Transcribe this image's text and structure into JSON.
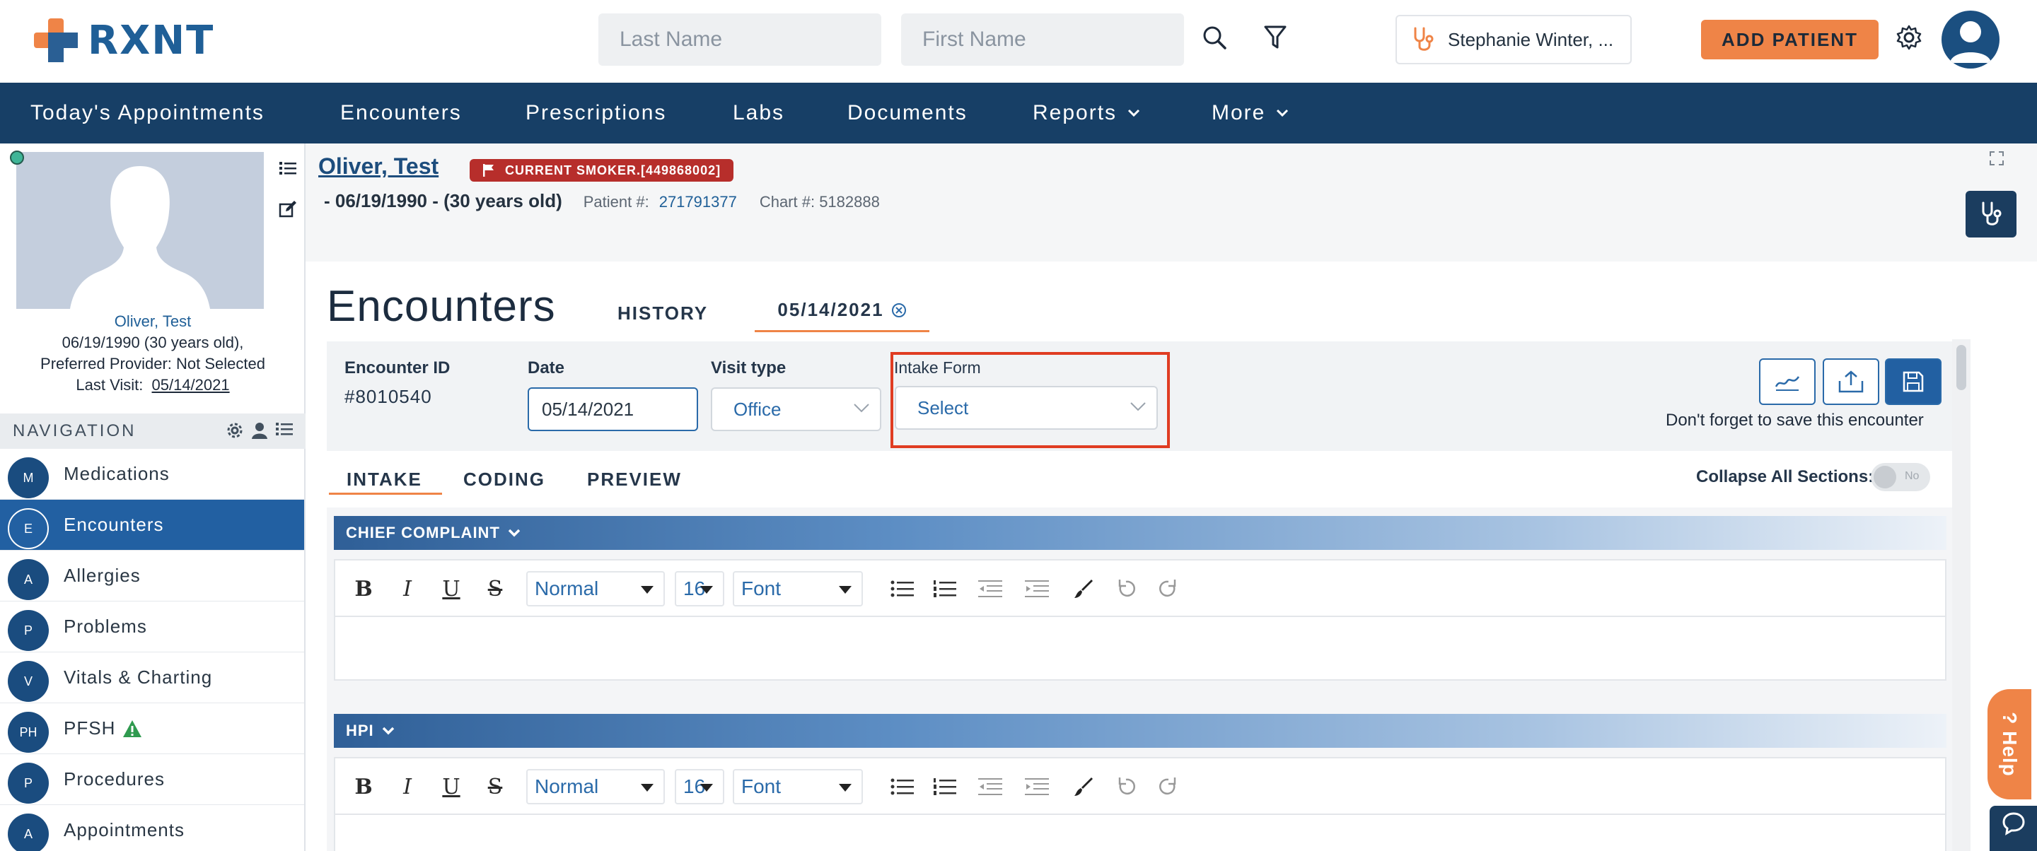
{
  "app": {
    "logo_text": "RXNT",
    "brand_color": "#1f5f97",
    "accent_color": "#ef8447"
  },
  "header": {
    "last_name_placeholder": "Last Name",
    "first_name_placeholder": "First Name",
    "search_icon": "search-icon",
    "filter_icon": "filter-icon",
    "provider_name": "Stephanie Winter, ...",
    "add_patient_label": "ADD PATIENT",
    "settings_icon": "gear-icon",
    "user_icon": "user-avatar-icon"
  },
  "topnav": {
    "items": [
      {
        "label": "Today's Appointments"
      },
      {
        "label": "Encounters"
      },
      {
        "label": "Prescriptions"
      },
      {
        "label": "Labs"
      },
      {
        "label": "Documents"
      },
      {
        "label": "Reports"
      },
      {
        "label": "More"
      }
    ]
  },
  "patient_card": {
    "name": "Oliver, Test",
    "dob_age": "06/19/1990 (30 years old),",
    "preferred_provider": "Preferred Provider: Not Selected",
    "last_visit_label": "Last Visit:",
    "last_visit_date": "05/14/2021"
  },
  "sidebar": {
    "nav_title": "NAVIGATION",
    "items": [
      {
        "badge": "M",
        "label": "Medications"
      },
      {
        "badge": "E",
        "label": "Encounters",
        "active": true
      },
      {
        "badge": "A",
        "label": "Allergies"
      },
      {
        "badge": "P",
        "label": "Problems"
      },
      {
        "badge": "V",
        "label": "Vitals & Charting"
      },
      {
        "badge": "PH",
        "label": "PFSH",
        "warning_icon": "warning-icon"
      },
      {
        "badge": "P",
        "label": "Procedures"
      },
      {
        "badge": "A",
        "label": "Appointments"
      }
    ]
  },
  "banner": {
    "patient_name": "Oliver, Test",
    "alert": "CURRENT SMOKER.[449868002]",
    "dob": "- 06/19/1990 - (30 years old)",
    "patient_no_label": "Patient #:",
    "patient_no": "271791377",
    "chart_no": "Chart #: 5182888"
  },
  "encounter": {
    "title": "Encounters",
    "tab_history": "HISTORY",
    "tab_current": "05/14/2021",
    "id_label": "Encounter ID",
    "id_value": "#8010540",
    "date_label": "Date",
    "date_value": "05/14/2021",
    "visit_type_label": "Visit type",
    "visit_type_value": "Office",
    "intake_form_label": "Intake Form",
    "intake_form_value": "Select",
    "save_note": "Don't forget to save this encounter"
  },
  "subtabs": {
    "intake": "INTAKE",
    "coding": "CODING",
    "preview": "PREVIEW",
    "collapse_label": "Collapse All Sections:",
    "collapse_value": "No"
  },
  "sections": [
    {
      "title": "CHIEF COMPLAINT"
    },
    {
      "title": "HPI"
    }
  ],
  "editor_toolbar": {
    "bold": "B",
    "italic": "I",
    "underline": "U",
    "strike": "S",
    "style": "Normal",
    "size": "16",
    "font": "Font"
  },
  "help": {
    "label": "? Help"
  }
}
